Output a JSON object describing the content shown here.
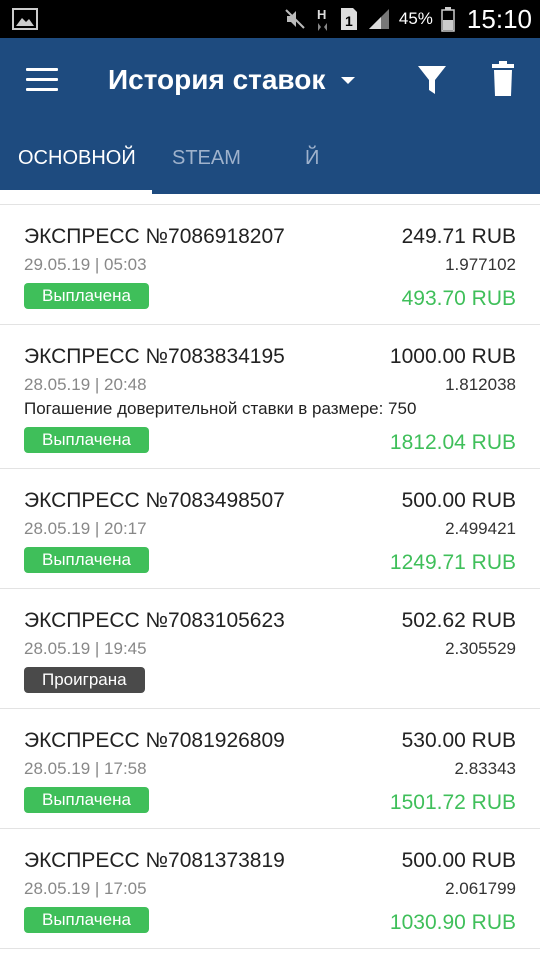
{
  "status_bar": {
    "battery_percent": "45%",
    "time": "15:10",
    "left_icon": "image-icon",
    "icons": [
      "mute-icon",
      "h-data-icon",
      "sim1-icon",
      "signal-icon",
      "battery-icon"
    ]
  },
  "app_bar": {
    "title": "История ставок",
    "menu_icon": "menu-icon",
    "dropdown_icon": "caret-down-icon",
    "filter_icon": "filter-icon",
    "delete_icon": "trash-icon",
    "background_color": "#1e4b7f"
  },
  "tabs": [
    {
      "label": "ОСНОВНОЙ",
      "active": true
    },
    {
      "label": "STEAM",
      "active": false
    },
    {
      "label": "Й",
      "active": false
    }
  ],
  "bets": [
    {
      "title": "ЭКСПРЕСС №7086918207",
      "datetime": "29.05.19 | 05:03",
      "amount": "249.71 RUB",
      "coefficient": "1.977102",
      "status": "Выплачена",
      "payout": "493.70 RUB",
      "note": ""
    },
    {
      "title": "ЭКСПРЕСС №7083834195",
      "datetime": "28.05.19 | 20:48",
      "amount": "1000.00 RUB",
      "coefficient": "1.812038",
      "status": "Выплачена",
      "payout": "1812.04 RUB",
      "note": "Погашение доверительной ставки в размере: 750"
    },
    {
      "title": "ЭКСПРЕСС №7083498507",
      "datetime": "28.05.19 | 20:17",
      "amount": "500.00 RUB",
      "coefficient": "2.499421",
      "status": "Выплачена",
      "payout": "1249.71 RUB",
      "note": ""
    },
    {
      "title": "ЭКСПРЕСС №7083105623",
      "datetime": "28.05.19 | 19:45",
      "amount": "502.62 RUB",
      "coefficient": "2.305529",
      "status": "Проиграна",
      "payout": "",
      "note": ""
    },
    {
      "title": "ЭКСПРЕСС №7081926809",
      "datetime": "28.05.19 | 17:58",
      "amount": "530.00 RUB",
      "coefficient": "2.83343",
      "status": "Выплачена",
      "payout": "1501.72 RUB",
      "note": ""
    },
    {
      "title": "ЭКСПРЕСС №7081373819",
      "datetime": "28.05.19 | 17:05",
      "amount": "500.00 RUB",
      "coefficient": "2.061799",
      "status": "Выплачена",
      "payout": "1030.90 RUB",
      "note": ""
    }
  ],
  "colors": {
    "win_badge": "#3fbf5a",
    "lose_badge": "#4a4a4a",
    "payout_text": "#3fbf5a"
  }
}
